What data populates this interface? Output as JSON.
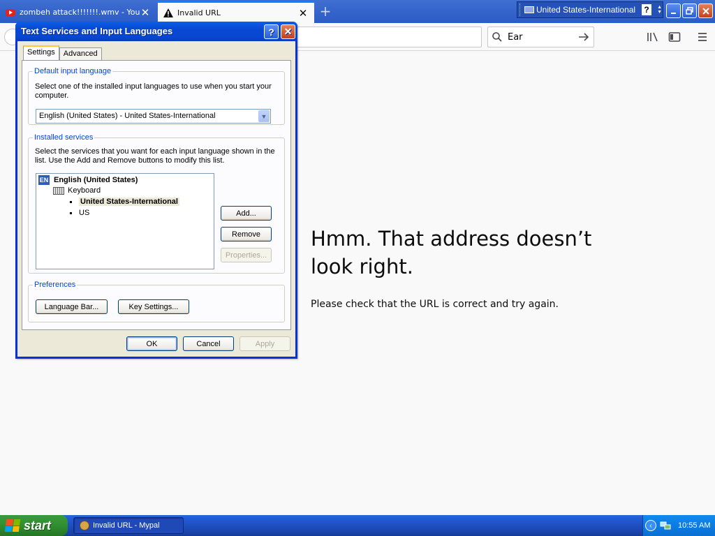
{
  "browser": {
    "tabs": [
      {
        "title": "zombeh attack!!!!!!!.wmv - YouTu",
        "icon": "youtube-icon",
        "active": false
      },
      {
        "title": "Invalid URL",
        "icon": "warning-icon",
        "active": true
      }
    ],
    "new_tab_label": "+",
    "search_text": "Ear",
    "tab_close_glyph": "✕"
  },
  "language_bar": {
    "language": "United States-International",
    "help": "?"
  },
  "error_page": {
    "title": "Hmm. That address doesn’t look right.",
    "description": "Please check that the URL is correct and try again."
  },
  "dialog": {
    "title": "Text Services and Input Languages",
    "help_glyph": "?",
    "close_glyph": "✕",
    "tabs": [
      {
        "label": "Settings",
        "selected": true
      },
      {
        "label": "Advanced",
        "selected": false
      }
    ],
    "default_language": {
      "legend": "Default input language",
      "text": "Select one of the installed input languages to use when you start your computer.",
      "selected": "English (United States) - United States-International"
    },
    "installed_services": {
      "legend": "Installed services",
      "text": "Select the services that you want for each input language shown in the list. Use the Add and Remove buttons to modify this list.",
      "tree": {
        "language_badge": "EN",
        "language": "English (United States)",
        "category": "Keyboard",
        "items": [
          "United States-International",
          "US"
        ],
        "selected_item": "United States-International"
      },
      "buttons": {
        "add": "Add...",
        "remove": "Remove",
        "properties": "Properties..."
      }
    },
    "preferences": {
      "legend": "Preferences",
      "language_bar": "Language Bar...",
      "key_settings": "Key Settings..."
    },
    "footer": {
      "ok": "OK",
      "cancel": "Cancel",
      "apply": "Apply"
    }
  },
  "taskbar": {
    "start": "start",
    "task": "Invalid URL - Mypal",
    "clock": "10:55 AM"
  }
}
